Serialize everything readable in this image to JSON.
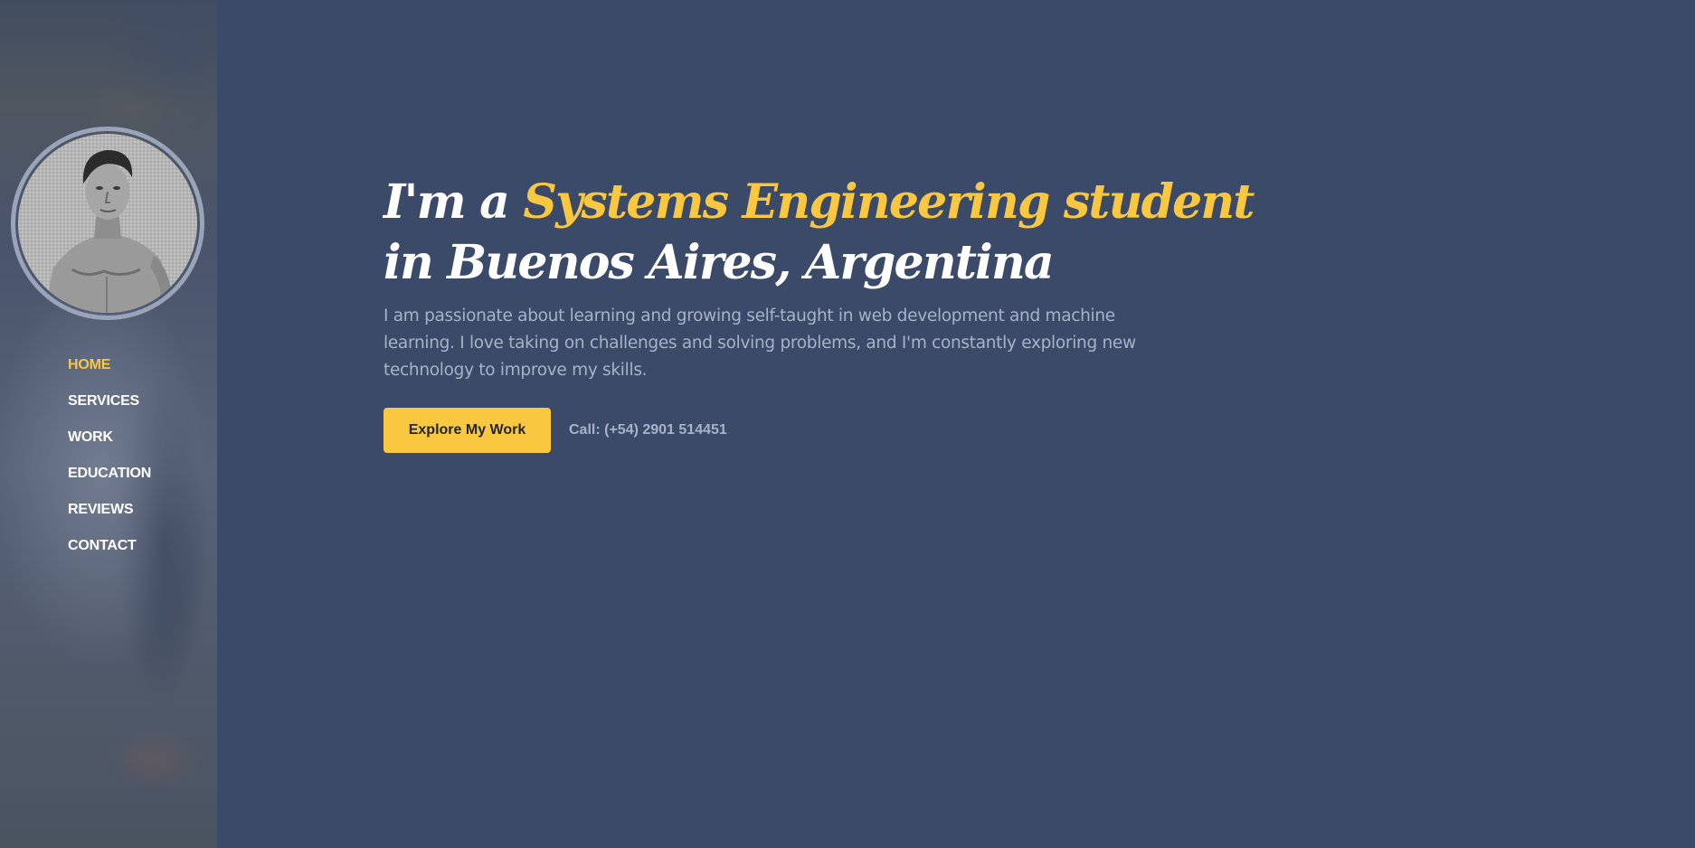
{
  "nav": {
    "items": [
      {
        "label": "HOME",
        "active": true
      },
      {
        "label": "SERVICES",
        "active": false
      },
      {
        "label": "WORK",
        "active": false
      },
      {
        "label": "EDUCATION",
        "active": false
      },
      {
        "label": "REVIEWS",
        "active": false
      },
      {
        "label": "CONTACT",
        "active": false
      }
    ]
  },
  "hero": {
    "headline_prefix": "I'm a ",
    "headline_accent": "Systems Engineering student",
    "headline_line2": "in Buenos Aires, Argentina",
    "intro": "I am passionate about learning and growing self-taught in web development and machine learning. I love taking on challenges and solving problems, and I'm constantly exploring new technology to improve my skills.",
    "cta_label": "Explore My Work",
    "call_text": "Call: (+54) 2901 514451"
  },
  "colors": {
    "background": "#3b4a69",
    "accent": "#f9c740",
    "muted_text": "#a9b2c6",
    "heading": "#ffffff"
  }
}
